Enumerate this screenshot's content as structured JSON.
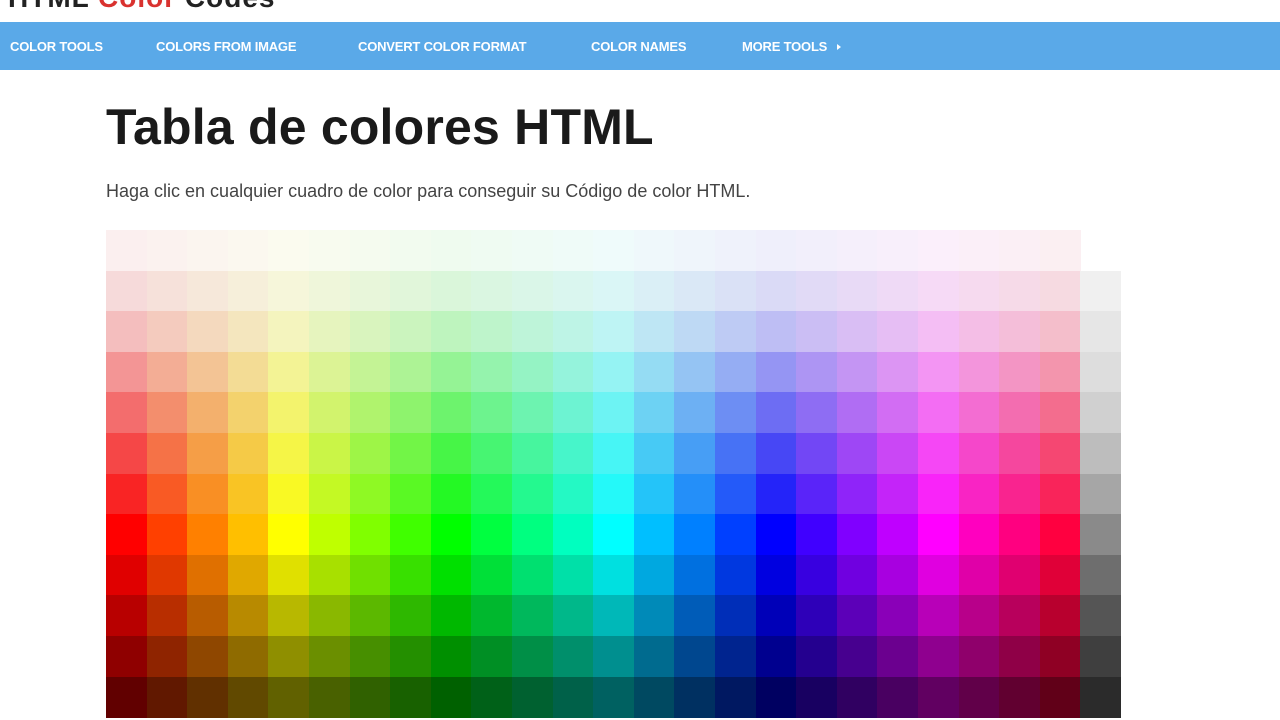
{
  "site": {
    "logo_prefix": "HTML",
    "logo_highlight": "Color",
    "logo_suffix": "Codes"
  },
  "nav": {
    "items": [
      {
        "label": "COLOR TOOLS"
      },
      {
        "label": "COLORS FROM IMAGE"
      },
      {
        "label": "CONVERT COLOR FORMAT"
      },
      {
        "label": "COLOR NAMES"
      },
      {
        "label": "MORE TOOLS",
        "has_dropdown": true
      }
    ]
  },
  "page": {
    "title": "Tabla de colores HTML",
    "subtitle": "Haga clic en cualquier cuadro de color para conseguir su Código de color HTML."
  },
  "colors": {
    "nav_bg": "#5aa9e8",
    "hue_columns": 24,
    "gray_column": true,
    "rows": [
      {
        "saturation": 60,
        "lightness": 96
      },
      {
        "saturation": 60,
        "lightness": 91
      },
      {
        "saturation": 70,
        "lightness": 85
      },
      {
        "saturation": 80,
        "lightness": 77
      },
      {
        "saturation": 85,
        "lightness": 69
      },
      {
        "saturation": 90,
        "lightness": 62
      },
      {
        "saturation": 95,
        "lightness": 56
      },
      {
        "saturation": 100,
        "lightness": 50
      },
      {
        "saturation": 100,
        "lightness": 44
      },
      {
        "saturation": 100,
        "lightness": 36
      },
      {
        "saturation": 100,
        "lightness": 28
      },
      {
        "saturation": 100,
        "lightness": 19
      }
    ],
    "gray_levels": [
      "#f7f7f7",
      "#f0f0f0",
      "#e6e6e6",
      "#dddddd",
      "#d0d0d0",
      "#bdbdbd",
      "#a6a6a6",
      "#8a8a8a",
      "#6e6e6e",
      "#555555",
      "#3f3f3f",
      "#2b2b2b"
    ]
  }
}
